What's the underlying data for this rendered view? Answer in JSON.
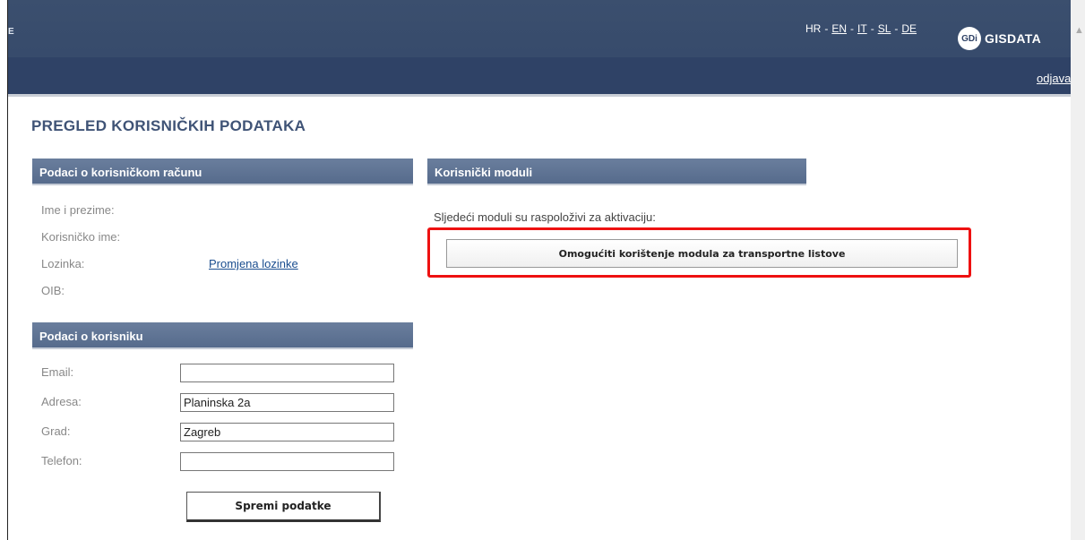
{
  "header": {
    "languages": [
      {
        "code": "HR",
        "active": true
      },
      {
        "code": "EN",
        "active": false
      },
      {
        "code": "IT",
        "active": false
      },
      {
        "code": "SL",
        "active": false
      },
      {
        "code": "DE",
        "active": false
      }
    ],
    "edge_letter": "E",
    "logo_badge": "GDi",
    "logo_text": "GISDATA",
    "logout_label": "odjava"
  },
  "page_title": "PREGLED KORISNIČKIH PODATAKA",
  "account": {
    "header": "Podaci o korisničkom računu",
    "name_label": "Ime i prezime:",
    "username_label": "Korisničko ime:",
    "password_label": "Lozinka:",
    "password_link": "Promjena lozinke",
    "oib_label": "OIB:"
  },
  "user": {
    "header": "Podaci o korisniku",
    "email_label": "Email:",
    "email_value": "",
    "address_label": "Adresa:",
    "address_value": "Planinska 2a",
    "city_label": "Grad:",
    "city_value": "Zagreb",
    "phone_label": "Telefon:",
    "phone_value": "",
    "save_label": "Spremi podatke"
  },
  "modules": {
    "header": "Korisnički moduli",
    "available_text": "Sljedeći moduli su raspoloživi za aktivaciju:",
    "enable_button": "Omogućiti korištenje modula za transportne listove"
  },
  "colors": {
    "header_bg": "#34486a",
    "section_header_bg": "#5f7394",
    "title_color": "#3f5376",
    "highlight": "#ee1111",
    "link": "#1a4d8f"
  }
}
